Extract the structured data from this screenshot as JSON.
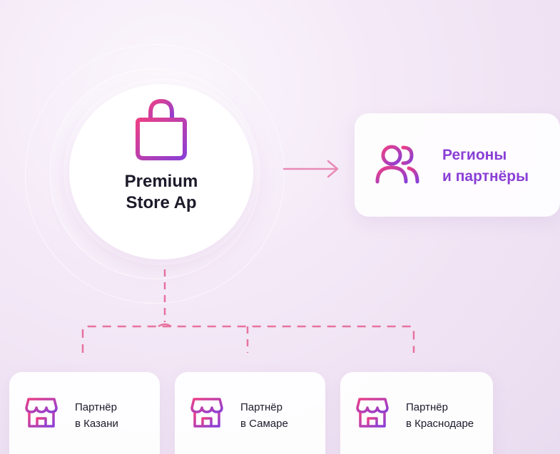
{
  "hub": {
    "title_line1": "Premium",
    "title_line2": "Store Ap",
    "icon": "shopping-bag-icon"
  },
  "regions": {
    "line1": "Регионы",
    "line2": "и партнёры",
    "icon": "users-icon"
  },
  "partners": [
    {
      "line1": "Партнёр",
      "line2": "в Казани",
      "icon": "storefront-icon"
    },
    {
      "line1": "Партнёр",
      "line2": "в Самаре",
      "icon": "storefront-icon"
    },
    {
      "line1": "Партнёр",
      "line2": "в Краснодаре",
      "icon": "storefront-icon"
    }
  ],
  "colors": {
    "accent_purple": "#8a3fd6",
    "accent_pink": "#e8407a",
    "connector": "#e7739f",
    "arrow": "#e98ab7"
  }
}
